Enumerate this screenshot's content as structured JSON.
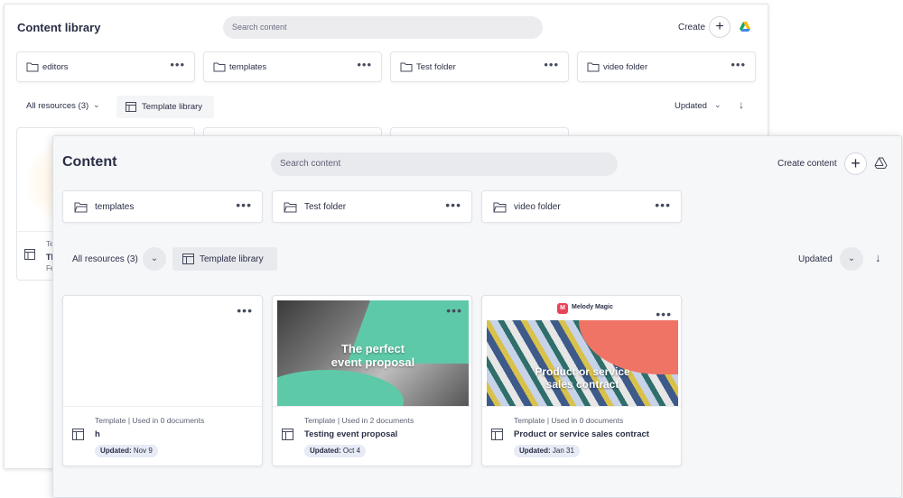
{
  "back": {
    "title": "Content library",
    "search_placeholder": "Search content",
    "create_label": "Create",
    "folders": [
      {
        "name": "editors"
      },
      {
        "name": "templates"
      },
      {
        "name": "Test folder"
      },
      {
        "name": "video folder"
      }
    ],
    "all_resources": "All resources (3)",
    "template_library": "Template library",
    "sort_label": "Updated",
    "card": {
      "meta": "Te",
      "name": "Th",
      "updated": "Fe"
    }
  },
  "front": {
    "title": "Content",
    "search_placeholder": "Search content",
    "create_label": "Create content",
    "folders": [
      {
        "name": "templates"
      },
      {
        "name": "Test folder"
      },
      {
        "name": "video folder"
      }
    ],
    "all_resources": "All resources (3)",
    "template_library": "Template library",
    "sort_label": "Updated",
    "cards": [
      {
        "meta": "Template | Used in 0 documents",
        "name": "h",
        "updated_label": "Updated:",
        "updated_value": "Nov 9",
        "thumb_text": ""
      },
      {
        "meta": "Template | Used in 2 documents",
        "name": "Testing event proposal",
        "updated_label": "Updated:",
        "updated_value": "Oct 4",
        "thumb_text_1": "The perfect",
        "thumb_text_2": "event proposal"
      },
      {
        "meta": "Template | Used in 0 documents",
        "name": "Product or service sales contract",
        "updated_label": "Updated:",
        "updated_value": "Jan 31",
        "brand": "Melody Magic",
        "brand_logo": "M",
        "thumb_text_1": "Product or service",
        "thumb_text_2": "sales contract"
      }
    ],
    "colors": {
      "accent_teal": "#5ec9a8",
      "accent_coral": "#ef7465",
      "badge_bg": "#e6ebf6"
    }
  }
}
